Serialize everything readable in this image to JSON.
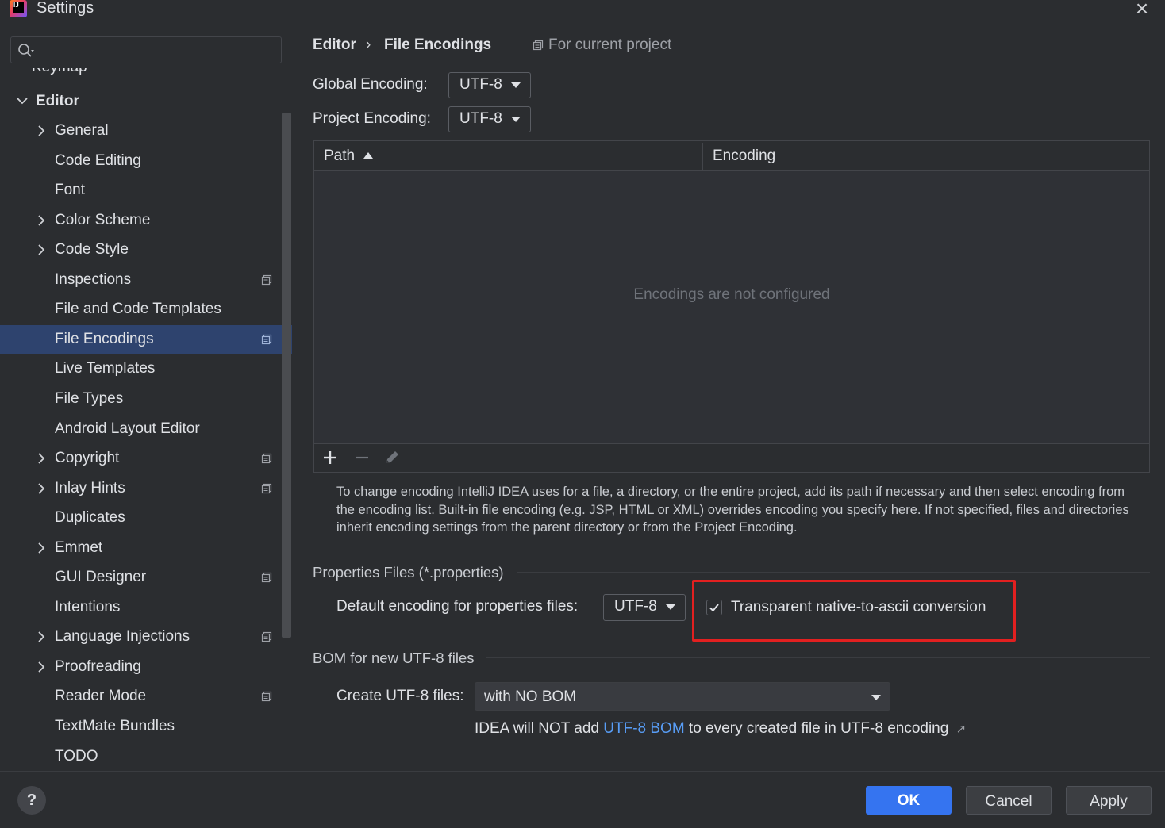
{
  "window": {
    "title": "Settings",
    "app_logo_text": "IJ",
    "close_glyph": "×"
  },
  "search": {
    "icon": "search-icon",
    "value": "",
    "placeholder": ""
  },
  "sidebar": {
    "partial_item": "Keymap",
    "editor": {
      "label": "Editor",
      "expanded": true
    },
    "items": [
      {
        "label": "General",
        "expandable": true,
        "project_icon": false
      },
      {
        "label": "Code Editing",
        "expandable": false,
        "project_icon": false
      },
      {
        "label": "Font",
        "expandable": false,
        "project_icon": false
      },
      {
        "label": "Color Scheme",
        "expandable": true,
        "project_icon": false
      },
      {
        "label": "Code Style",
        "expandable": true,
        "project_icon": false
      },
      {
        "label": "Inspections",
        "expandable": false,
        "project_icon": true
      },
      {
        "label": "File and Code Templates",
        "expandable": false,
        "project_icon": false
      },
      {
        "label": "File Encodings",
        "expandable": false,
        "project_icon": true,
        "selected": true
      },
      {
        "label": "Live Templates",
        "expandable": false,
        "project_icon": false
      },
      {
        "label": "File Types",
        "expandable": false,
        "project_icon": false
      },
      {
        "label": "Android Layout Editor",
        "expandable": false,
        "project_icon": false
      },
      {
        "label": "Copyright",
        "expandable": true,
        "project_icon": true
      },
      {
        "label": "Inlay Hints",
        "expandable": true,
        "project_icon": true
      },
      {
        "label": "Duplicates",
        "expandable": false,
        "project_icon": false
      },
      {
        "label": "Emmet",
        "expandable": true,
        "project_icon": false
      },
      {
        "label": "GUI Designer",
        "expandable": false,
        "project_icon": true
      },
      {
        "label": "Intentions",
        "expandable": false,
        "project_icon": false
      },
      {
        "label": "Language Injections",
        "expandable": true,
        "project_icon": true
      },
      {
        "label": "Proofreading",
        "expandable": true,
        "project_icon": false
      },
      {
        "label": "Reader Mode",
        "expandable": false,
        "project_icon": true
      },
      {
        "label": "TextMate Bundles",
        "expandable": false,
        "project_icon": false
      },
      {
        "label": "TODO",
        "expandable": false,
        "project_icon": false
      }
    ]
  },
  "breadcrumb": {
    "parent": "Editor",
    "separator": "›",
    "current": "File Encodings",
    "scope": "For current project"
  },
  "encodings": {
    "global_label": "Global Encoding:",
    "global_value": "UTF-8",
    "project_label": "Project Encoding:",
    "project_value": "UTF-8"
  },
  "table": {
    "columns": [
      "Path",
      "Encoding"
    ],
    "sort_column": "Path",
    "sort_direction": "ascending",
    "empty_text": "Encodings are not configured",
    "toolbar": [
      "add-icon",
      "remove-icon",
      "edit-icon"
    ]
  },
  "help_text": "To change encoding IntelliJ IDEA uses for a file, a directory, or the entire project, add its path if necessary and then select encoding from the encoding list. Built-in file encoding (e.g. JSP, HTML or XML) overrides encoding you specify here. If not specified, files and directories inherit encoding settings from the parent directory or from the Project Encoding.",
  "properties": {
    "section_title": "Properties Files (*.properties)",
    "default_label": "Default encoding for properties files:",
    "default_value": "UTF-8",
    "native_label": "Transparent native-to-ascii conversion",
    "native_checked": true
  },
  "bom": {
    "section_title": "BOM for new UTF-8 files",
    "create_label": "Create UTF-8 files:",
    "create_value": "with NO BOM",
    "note_prefix": "IDEA will NOT add ",
    "note_link": "UTF-8 BOM",
    "note_suffix": " to every created file in UTF-8 encoding",
    "note_arrow": "↗"
  },
  "footer": {
    "help": "?",
    "ok": "OK",
    "cancel": "Cancel",
    "apply": "Apply"
  },
  "colors": {
    "background": "#2b2d30",
    "selection": "#2e436e",
    "accent": "#3574f0",
    "link": "#589df6",
    "highlight_box": "#e22020"
  }
}
